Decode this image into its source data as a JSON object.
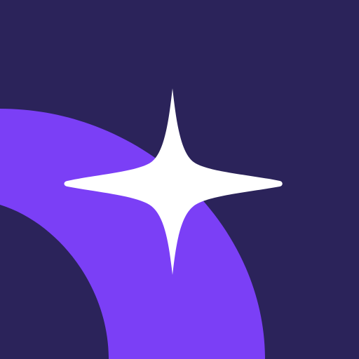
{
  "icon": {
    "name": "sparkle-arc-app-icon",
    "colors": {
      "background": "#2b235a",
      "arc": "#7b3ff6",
      "sparkle": "#ffffff"
    }
  }
}
